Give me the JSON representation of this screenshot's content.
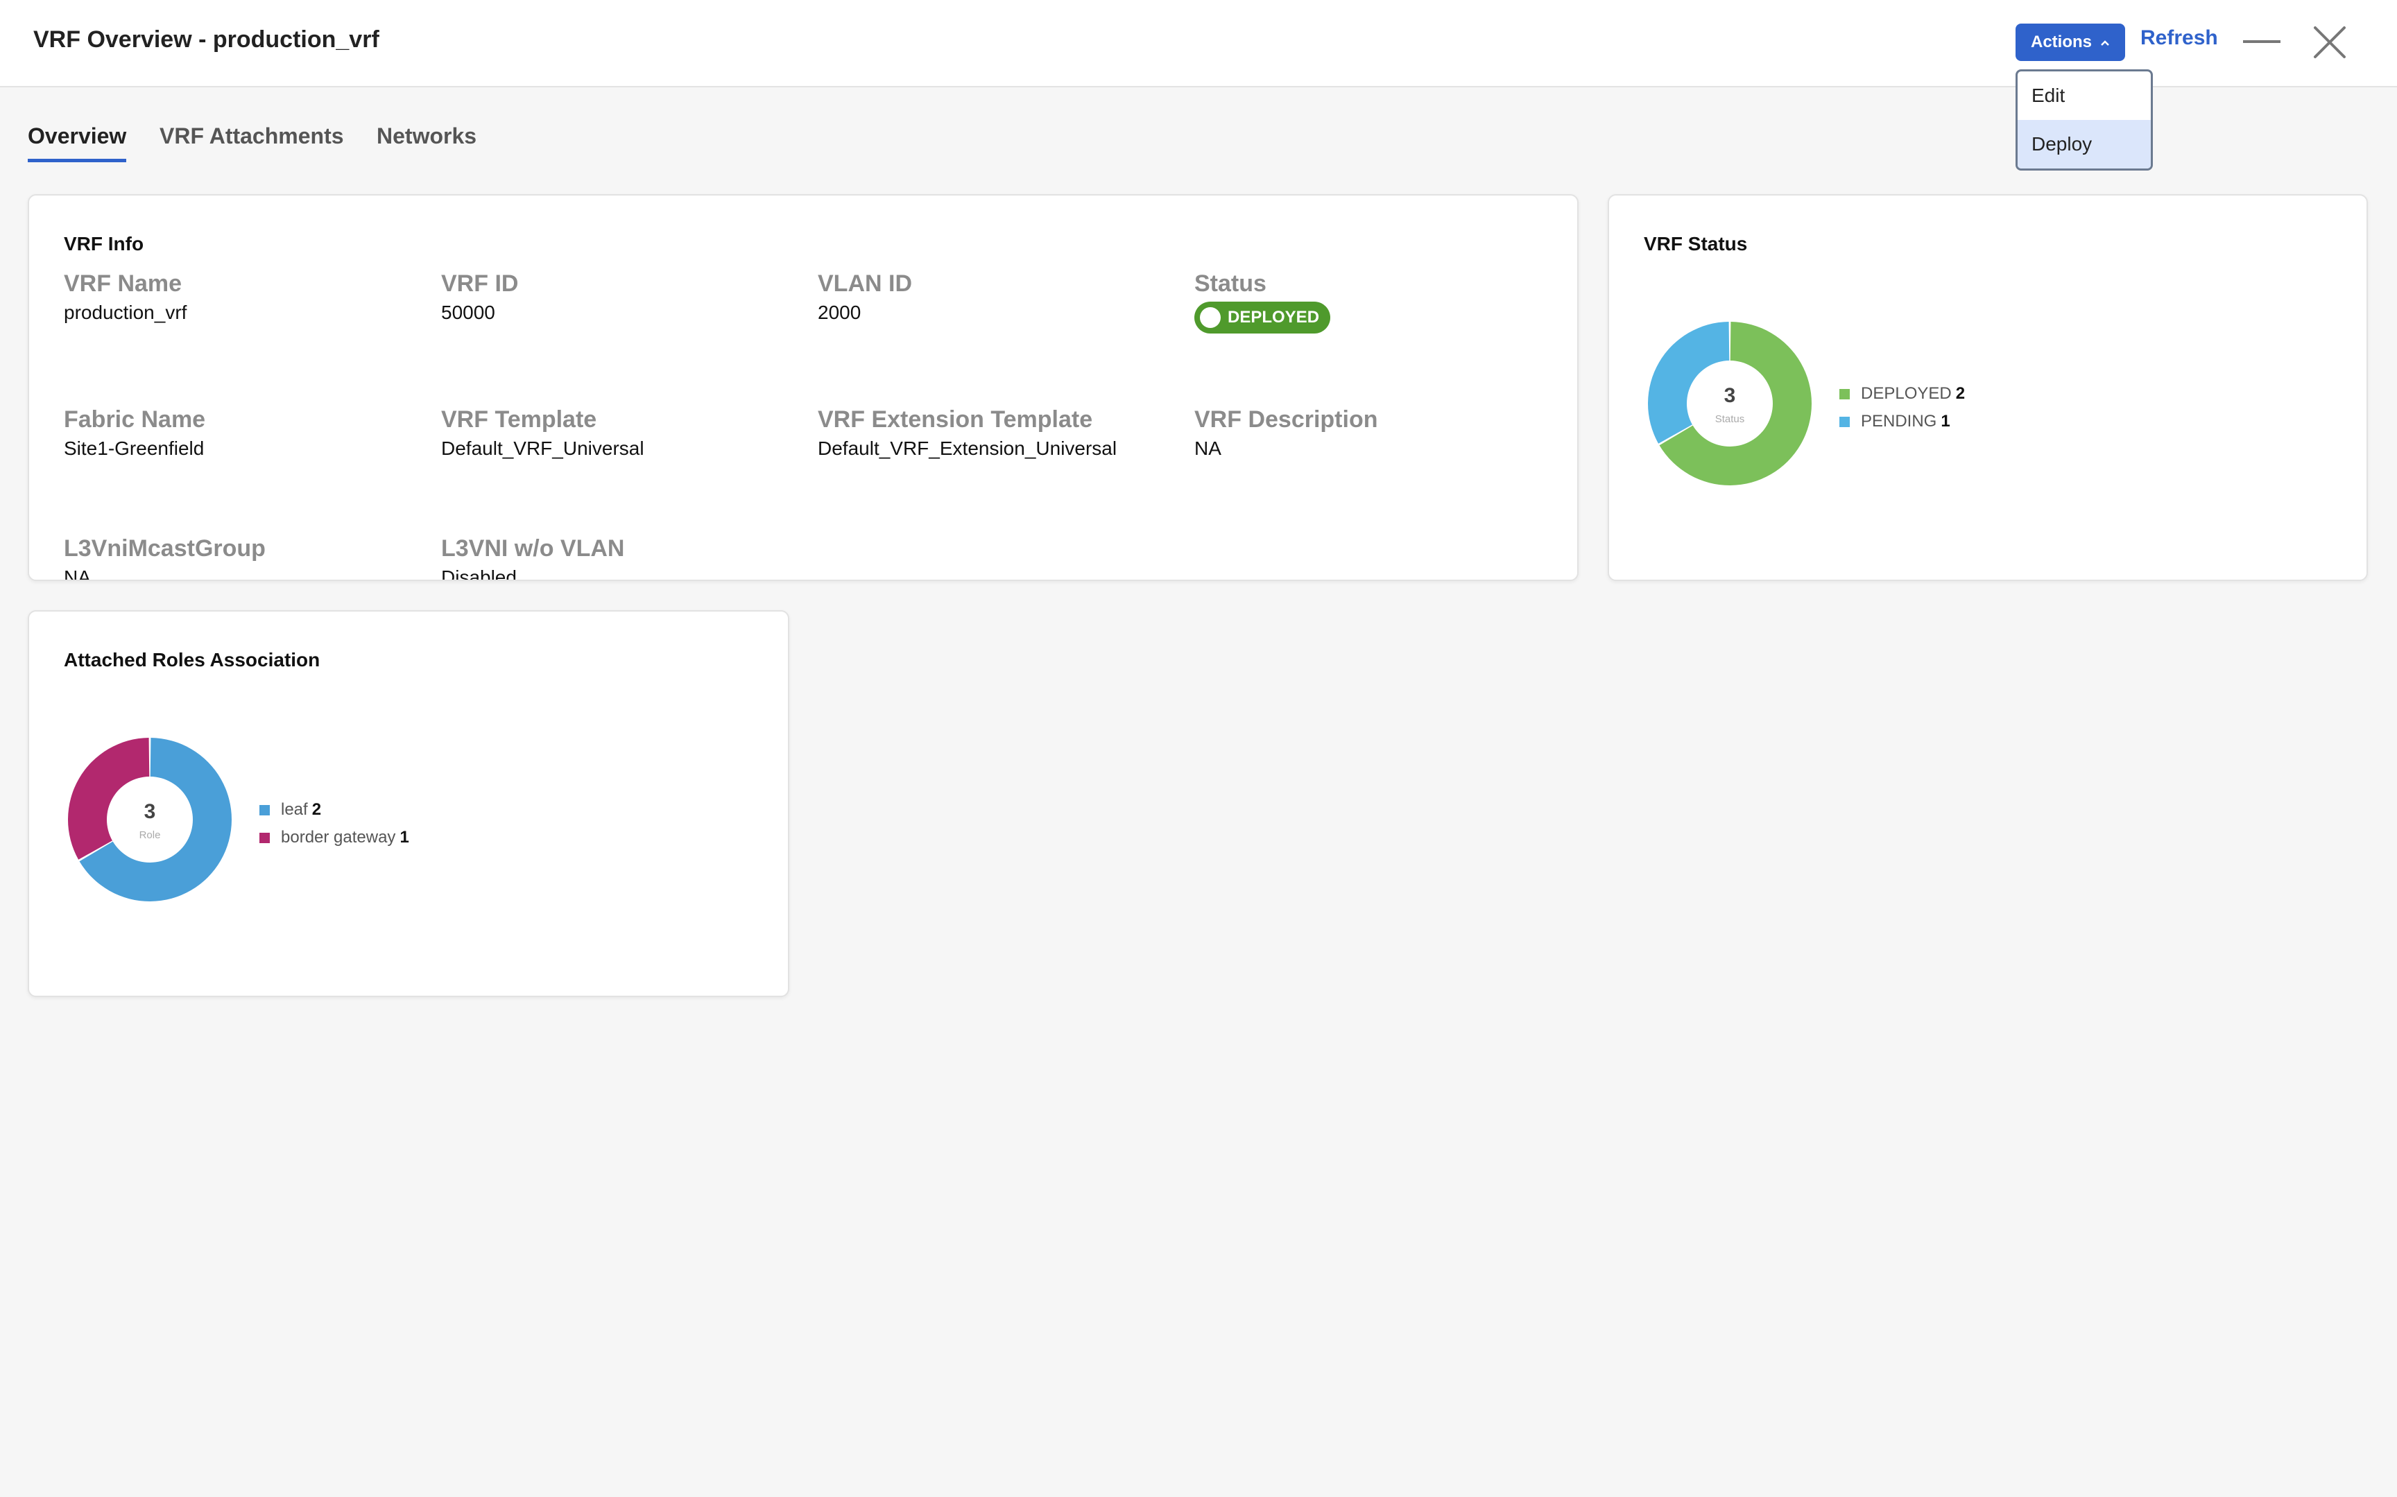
{
  "header": {
    "title": "VRF Overview - production_vrf",
    "actions_label": "Actions",
    "refresh_label": "Refresh"
  },
  "actions_menu": {
    "items": [
      "Edit",
      "Deploy"
    ],
    "highlighted": "Deploy"
  },
  "tabs": [
    {
      "label": "Overview",
      "active": true
    },
    {
      "label": "VRF Attachments",
      "active": false
    },
    {
      "label": "Networks",
      "active": false
    }
  ],
  "vrf_info": {
    "title": "VRF Info",
    "fields": {
      "vrf_name": {
        "label": "VRF Name",
        "value": "production_vrf"
      },
      "vrf_id": {
        "label": "VRF ID",
        "value": "50000"
      },
      "vlan_id": {
        "label": "VLAN ID",
        "value": "2000"
      },
      "status": {
        "label": "Status",
        "value": "DEPLOYED"
      },
      "fabric_name": {
        "label": "Fabric Name",
        "value": "Site1-Greenfield"
      },
      "vrf_template": {
        "label": "VRF Template",
        "value": "Default_VRF_Universal"
      },
      "vrf_extension_template": {
        "label": "VRF Extension Template",
        "value": "Default_VRF_Extension_Universal"
      },
      "vrf_description": {
        "label": "VRF Description",
        "value": "NA"
      },
      "l3vni_mcast_group": {
        "label": "L3VniMcastGroup",
        "value": "NA"
      },
      "l3vni_wo_vlan": {
        "label": "L3VNI w/o VLAN",
        "value": "Disabled"
      }
    }
  },
  "vrf_status": {
    "title": "VRF Status",
    "total": "3",
    "center_label": "Status",
    "segments": [
      {
        "name": "DEPLOYED",
        "value": 2,
        "color": "#7cc05a"
      },
      {
        "name": "PENDING",
        "value": 1,
        "color": "#54b4e4"
      }
    ]
  },
  "roles": {
    "title": "Attached Roles Association",
    "total": "3",
    "center_label": "Role",
    "segments": [
      {
        "name": "leaf",
        "value": 2,
        "color": "#4a9fd8"
      },
      {
        "name": "border gateway",
        "value": 1,
        "color": "#b2286e"
      }
    ]
  },
  "colors": {
    "accent": "#2f62cb",
    "deployed_pill": "#4f9a2c"
  }
}
